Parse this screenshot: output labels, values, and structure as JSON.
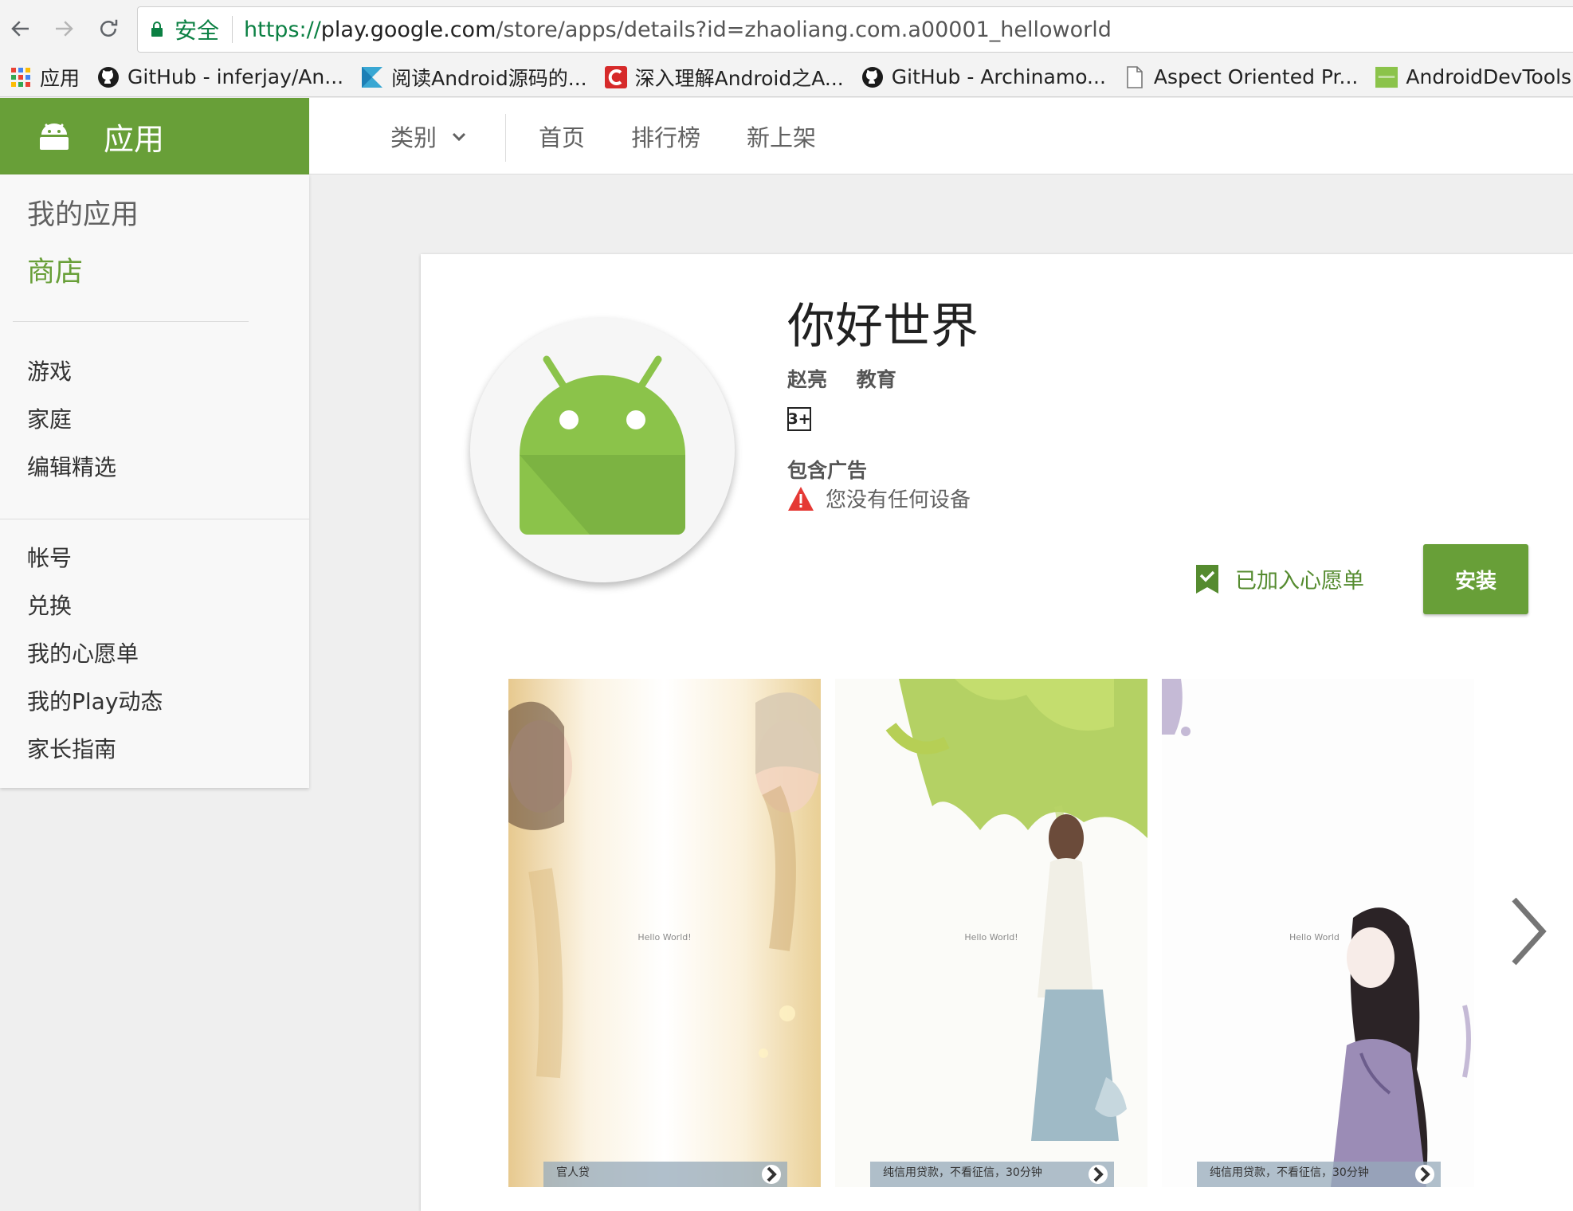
{
  "browser": {
    "secure_label": "安全",
    "url_scheme": "https://",
    "url_host": "play.google.com",
    "url_path": "/store/apps/details?id=zhaoliang.com.a00001_helloworld"
  },
  "bookmarks": [
    {
      "label": "应用",
      "icon": "apps-grid-icon"
    },
    {
      "label": "GitHub - inferjay/An...",
      "icon": "github-icon"
    },
    {
      "label": "阅读Android源码的...",
      "icon": "k-logo-icon"
    },
    {
      "label": "深入理解Android之A...",
      "icon": "c-logo-icon"
    },
    {
      "label": "GitHub - Archinamo...",
      "icon": "github-icon"
    },
    {
      "label": "Aspect Oriented Pr...",
      "icon": "document-icon"
    },
    {
      "label": "AndroidDevTools A...",
      "icon": "devtools-icon"
    }
  ],
  "store": {
    "brand_label": "应用",
    "category_label": "类别",
    "nav_links": [
      "首页",
      "排行榜",
      "新上架"
    ]
  },
  "sidebar": {
    "my_apps": "我的应用",
    "store": "商店",
    "categories": [
      "游戏",
      "家庭",
      "编辑精选"
    ],
    "account_items": [
      "帐号",
      "兑换",
      "我的心愿单",
      "我的Play动态",
      "家长指南"
    ]
  },
  "app": {
    "title": "你好世界",
    "developer": "赵亮",
    "category": "教育",
    "rating": "3+",
    "ads_label": "包含广告",
    "device_warning": "您没有任何设备",
    "wishlist_label": "已加入心愿单",
    "install_label": "安装"
  },
  "screenshots": [
    {
      "hello": "Hello World!",
      "banner": "官人贷"
    },
    {
      "hello": "Hello World!",
      "banner": "纯信用贷款，不看征信，30分钟"
    },
    {
      "hello": "Hello World",
      "banner": "纯信用贷款，不看征信，30分钟"
    }
  ],
  "colors": {
    "brand_green": "#689f38",
    "secure_green": "#0b8043",
    "android_green": "#8bc34a",
    "warning_red": "#e53935"
  }
}
